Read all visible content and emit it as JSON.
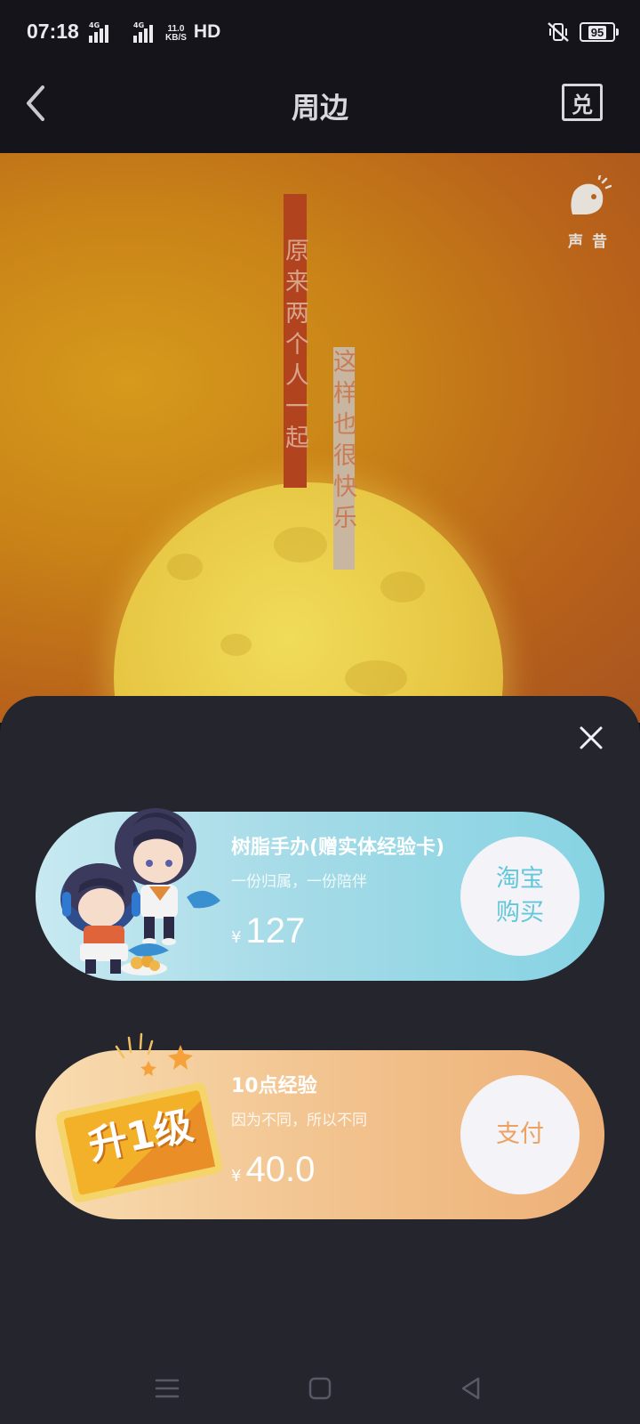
{
  "status_bar": {
    "time": "07:18",
    "sim1": "4G",
    "sim2": "4G",
    "speed_value": "11.0",
    "speed_unit": "KB/S",
    "hd": "HD",
    "battery": "95"
  },
  "nav": {
    "title": "周边",
    "redeem_label": "兑"
  },
  "banner": {
    "poem_line_1": "原来两个人一起",
    "poem_line_2": "这样也很快乐",
    "brand": "声昔"
  },
  "products": [
    {
      "title": "树脂手办(赠实体经验卡)",
      "subtitle": "一份归属，一份陪伴",
      "currency": "¥",
      "price": "127",
      "button_label": "淘宝购买"
    },
    {
      "title": "10点经验",
      "subtitle": "因为不同，所以不同",
      "currency": "¥",
      "price": "40.0",
      "button_label": "支付",
      "badge": "升1级"
    }
  ],
  "colors": {
    "card1_button_text": "#63c7dc",
    "card2_button_text": "#eea25f",
    "sheet_bg": "#25252e"
  }
}
